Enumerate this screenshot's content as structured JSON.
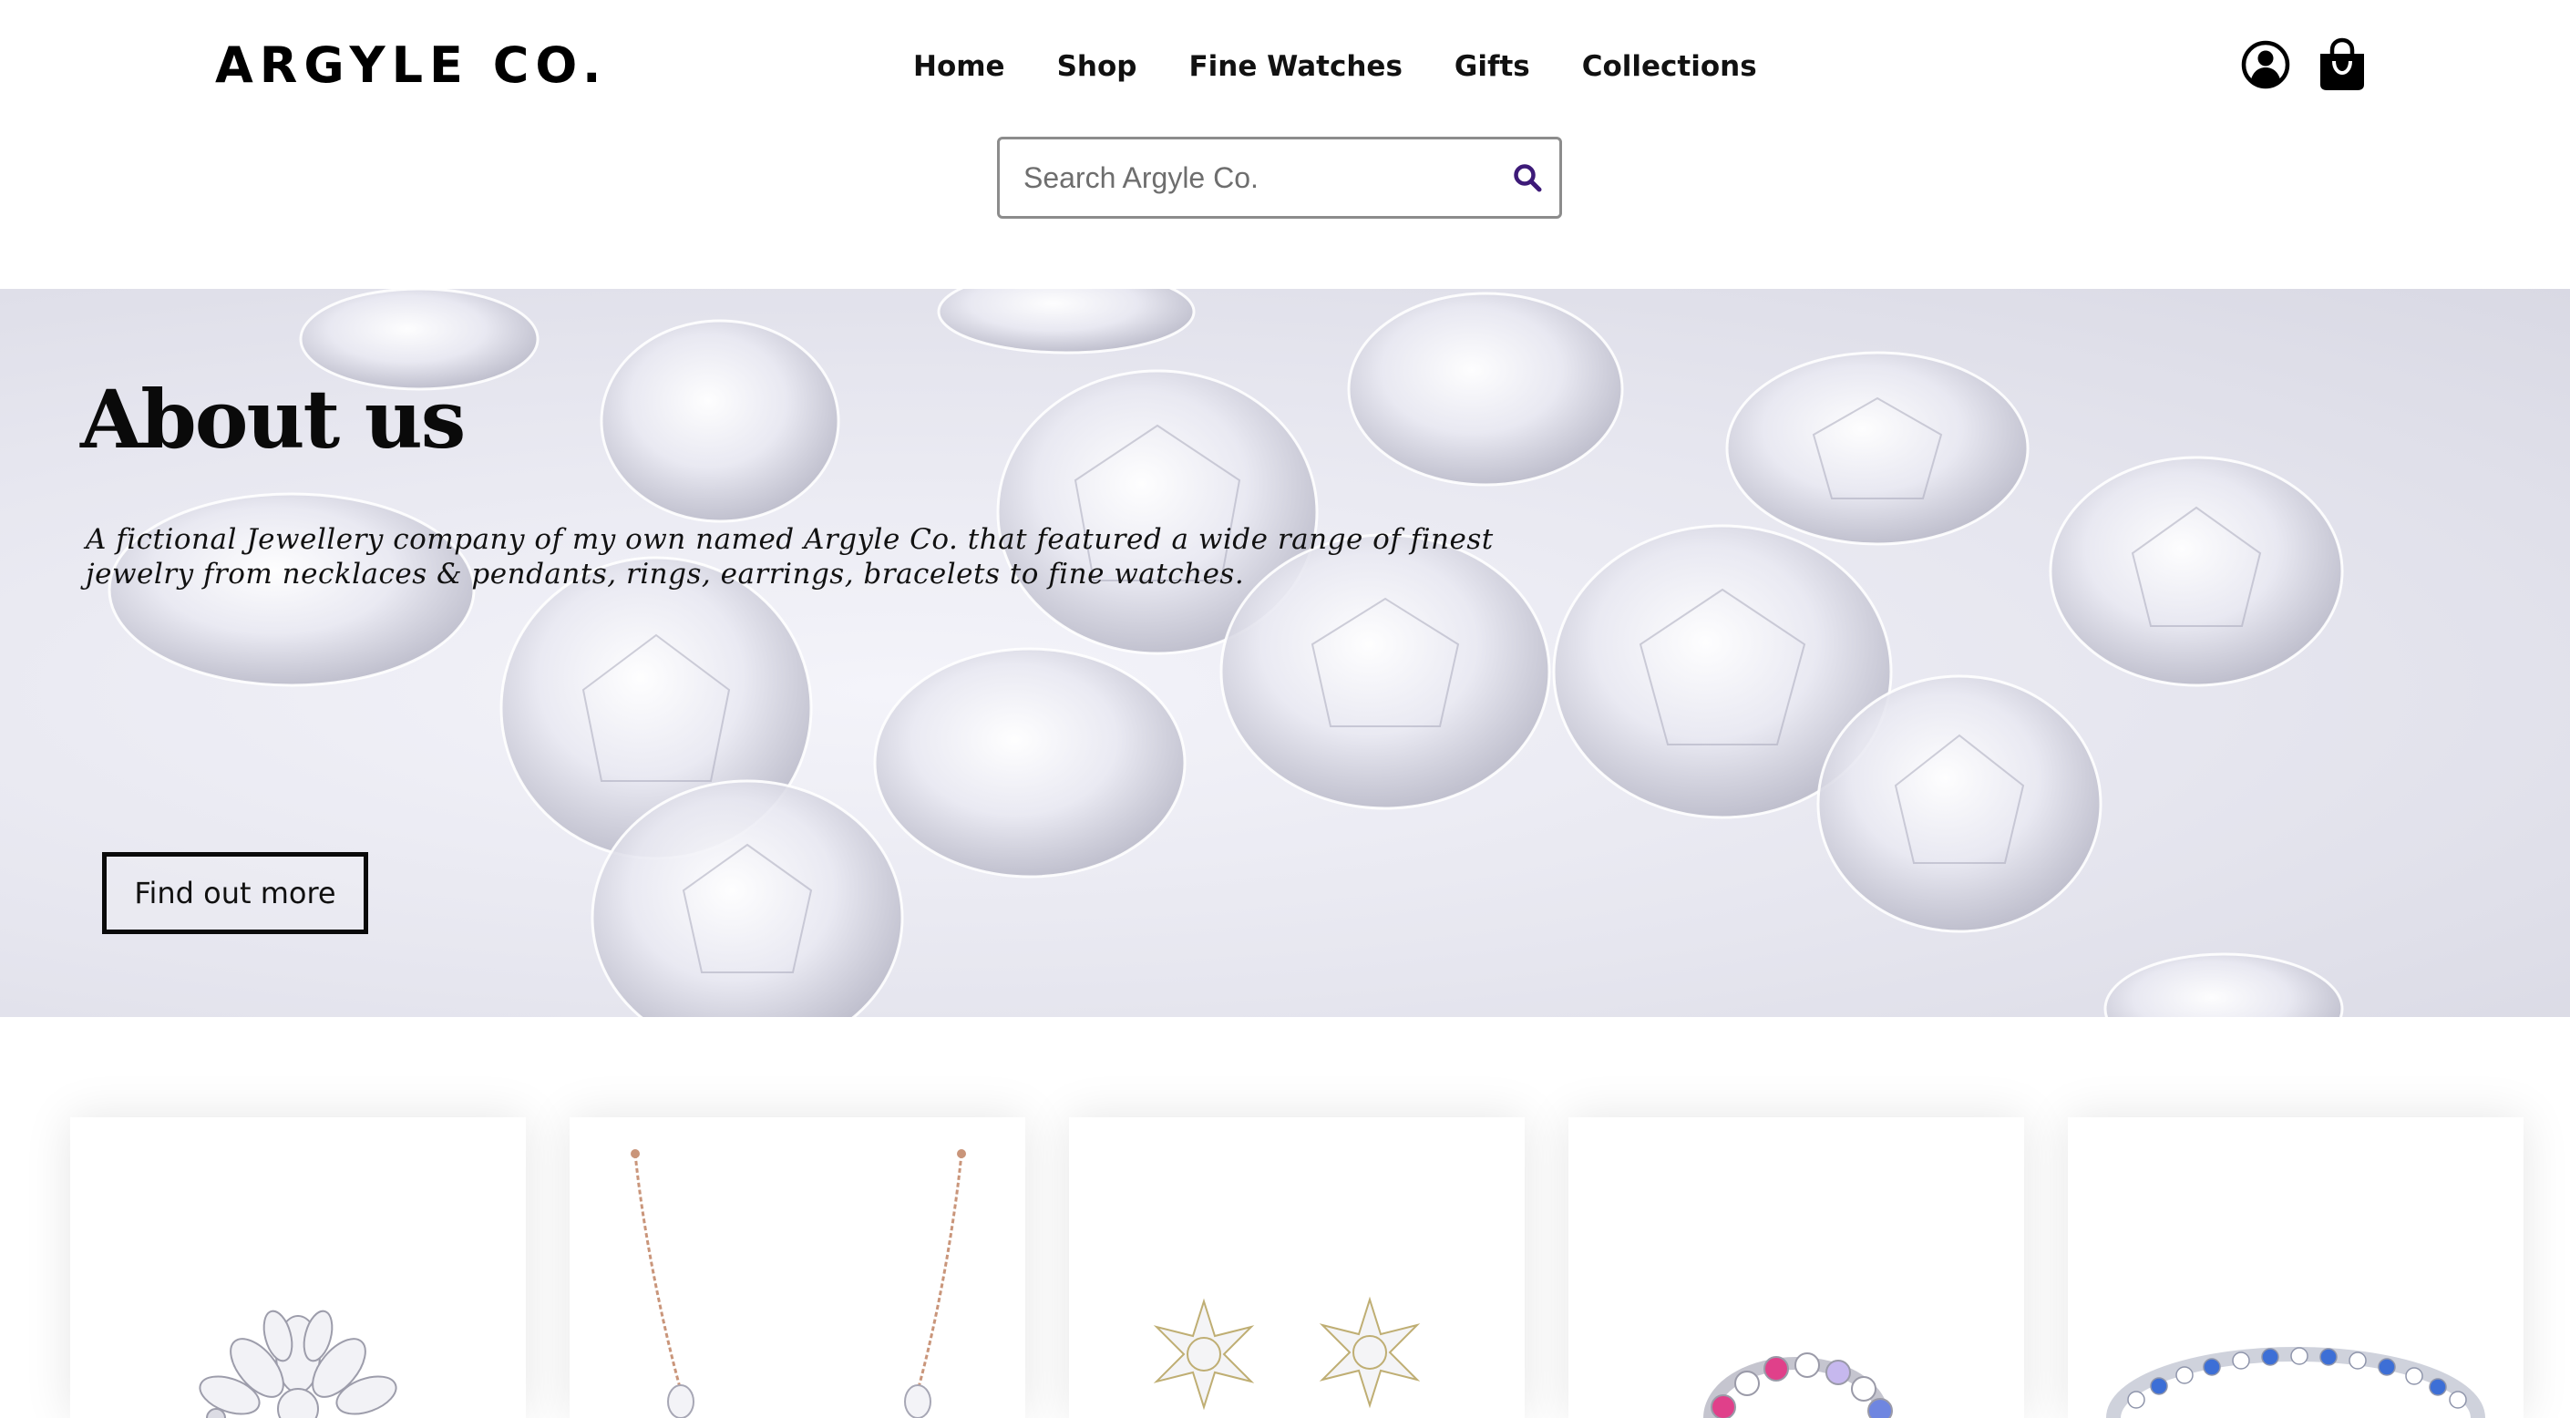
{
  "header": {
    "logo": "ARGYLE CO.",
    "nav": [
      {
        "label": "Home"
      },
      {
        "label": "Shop"
      },
      {
        "label": "Fine Watches"
      },
      {
        "label": "Gifts"
      },
      {
        "label": "Collections"
      }
    ],
    "icons": {
      "account": "user-circle-icon",
      "cart": "shopping-bag-icon",
      "search": "magnifier-icon"
    },
    "search": {
      "placeholder": "Search Argyle Co.",
      "value": ""
    }
  },
  "hero": {
    "title": "About us",
    "description": "A fictional Jewellery company of my own named Argyle Co. that featured a wide range of finest jewelry from necklaces & pendants, rings, earrings, bracelets to fine watches.",
    "button_label": "Find out more"
  },
  "products": [
    {
      "image": "diamond-brooch"
    },
    {
      "image": "rose-gold-pendant-necklace"
    },
    {
      "image": "diamond-cluster-earrings"
    },
    {
      "image": "pink-sapphire-eternity-ring"
    },
    {
      "image": "blue-sapphire-bracelet"
    }
  ],
  "colors": {
    "search_icon": "#3d1a78",
    "text": "#111111",
    "card_shadow": "rgba(0,0,0,0.10)",
    "hero_bg": "#e6e6ef",
    "rose_gold": "#c9957a",
    "pink_stone": "#e0408a",
    "blue_stone": "#3d6fd6"
  }
}
